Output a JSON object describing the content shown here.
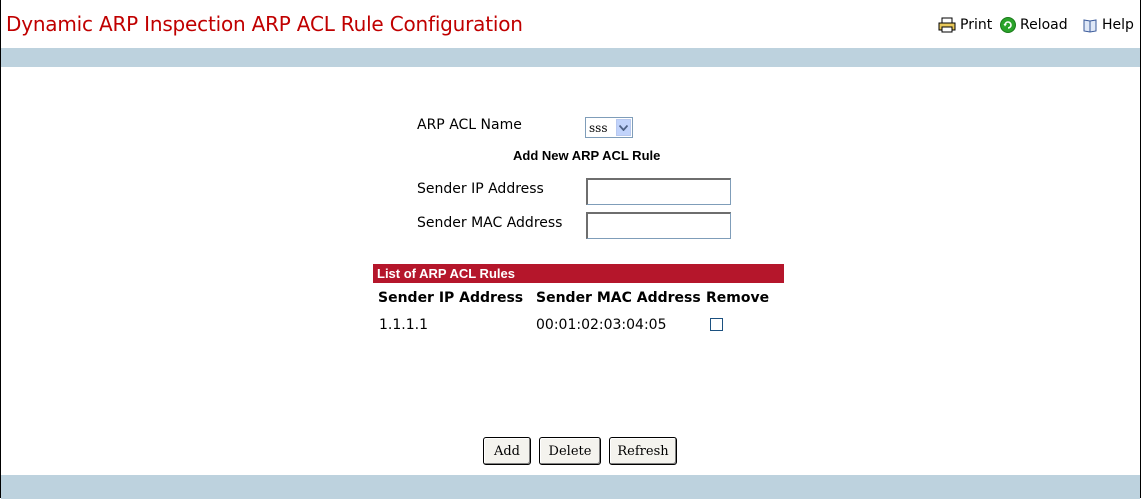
{
  "header": {
    "title": "Dynamic ARP Inspection ARP ACL Rule Configuration",
    "print_label": "Print",
    "reload_label": "Reload",
    "help_label": "Help"
  },
  "form": {
    "acl_name_label": "ARP ACL Name",
    "acl_name_value": "sss",
    "add_rule_heading": "Add New ARP ACL Rule",
    "sender_ip_label": "Sender IP Address",
    "sender_ip_value": "",
    "sender_mac_label": "Sender MAC Address",
    "sender_mac_value": ""
  },
  "rules": {
    "heading": "List of ARP ACL Rules",
    "columns": [
      "Sender IP Address",
      "Sender MAC Address",
      "Remove"
    ],
    "rows": [
      {
        "sender_ip": "1.1.1.1",
        "sender_mac": "00:01:02:03:04:05",
        "remove": false
      }
    ]
  },
  "buttons": {
    "add": "Add",
    "delete": "Delete",
    "refresh": "Refresh"
  },
  "colors": {
    "title": "#c00000",
    "band": "#bdd2de",
    "list_header": "#b5162b"
  },
  "icons": {
    "print": "printer-icon",
    "reload": "reload-icon",
    "help": "help-book-icon"
  }
}
